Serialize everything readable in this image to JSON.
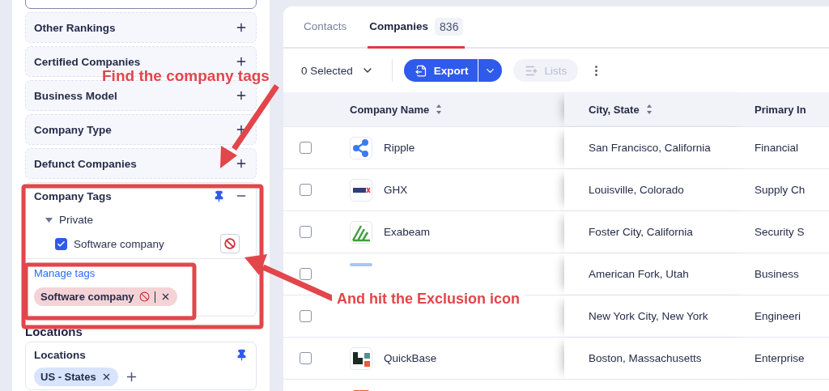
{
  "sidebar": {
    "filters": [
      {
        "label": "Other Rankings",
        "expanded": false
      },
      {
        "label": "Certified Companies",
        "expanded": false
      },
      {
        "label": "Business Model",
        "expanded": false
      },
      {
        "label": "Company Type",
        "expanded": false
      },
      {
        "label": "Defunct Companies",
        "expanded": false
      }
    ],
    "company_tags": {
      "title": "Company Tags",
      "pinned": true,
      "expanded": true,
      "groups": [
        {
          "label": "Private",
          "expanded": true,
          "items": [
            {
              "label": "Software company",
              "checked": true,
              "excluded": true
            }
          ]
        }
      ],
      "manage_link": "Manage tags",
      "chips": [
        {
          "label": "Software company",
          "excluded": true
        }
      ]
    },
    "locations_heading": "Locations",
    "locations": {
      "title": "Locations",
      "pinned": true,
      "chips": [
        {
          "label": "US - States"
        }
      ]
    }
  },
  "tabs": [
    {
      "label": "Contacts",
      "selected": false
    },
    {
      "label": "Companies",
      "count": "836",
      "selected": true
    }
  ],
  "toolbar": {
    "selection": "0 Selected",
    "export": "Export",
    "lists": {
      "label": "Lists",
      "disabled": true
    }
  },
  "table": {
    "columns": [
      {
        "label": "Company Name",
        "sortable": true
      },
      {
        "label": "City, State",
        "sortable": true
      },
      {
        "label": "Primary In"
      }
    ],
    "rows": [
      {
        "kind": "ripple",
        "name": "Ripple",
        "city": "San Francisco, California",
        "industry": "Financial",
        "checked": false
      },
      {
        "kind": "ghx",
        "name": "GHX",
        "city": "Louisville, Colorado",
        "industry": "Supply Ch",
        "checked": false
      },
      {
        "kind": "exabeam",
        "name": "Exabeam",
        "city": "Foster City, California",
        "industry": "Security S",
        "checked": false
      },
      {
        "kind": "partial",
        "city": "American Fork, Utah",
        "industry": "Business",
        "checked": false
      },
      {
        "kind": "blank",
        "city": "New York City, New York",
        "industry": "Engineeri",
        "checked": false
      },
      {
        "kind": "quickbase",
        "name": "QuickBase",
        "city": "Boston, Massachusetts",
        "industry": "Enterprise",
        "checked": false
      },
      {
        "kind": "circle"
      }
    ]
  },
  "annotations": [
    {
      "kind": "headline",
      "text": "Find the company tags"
    },
    {
      "kind": "callout",
      "text": "And hit the Exclusion icon"
    }
  ]
}
